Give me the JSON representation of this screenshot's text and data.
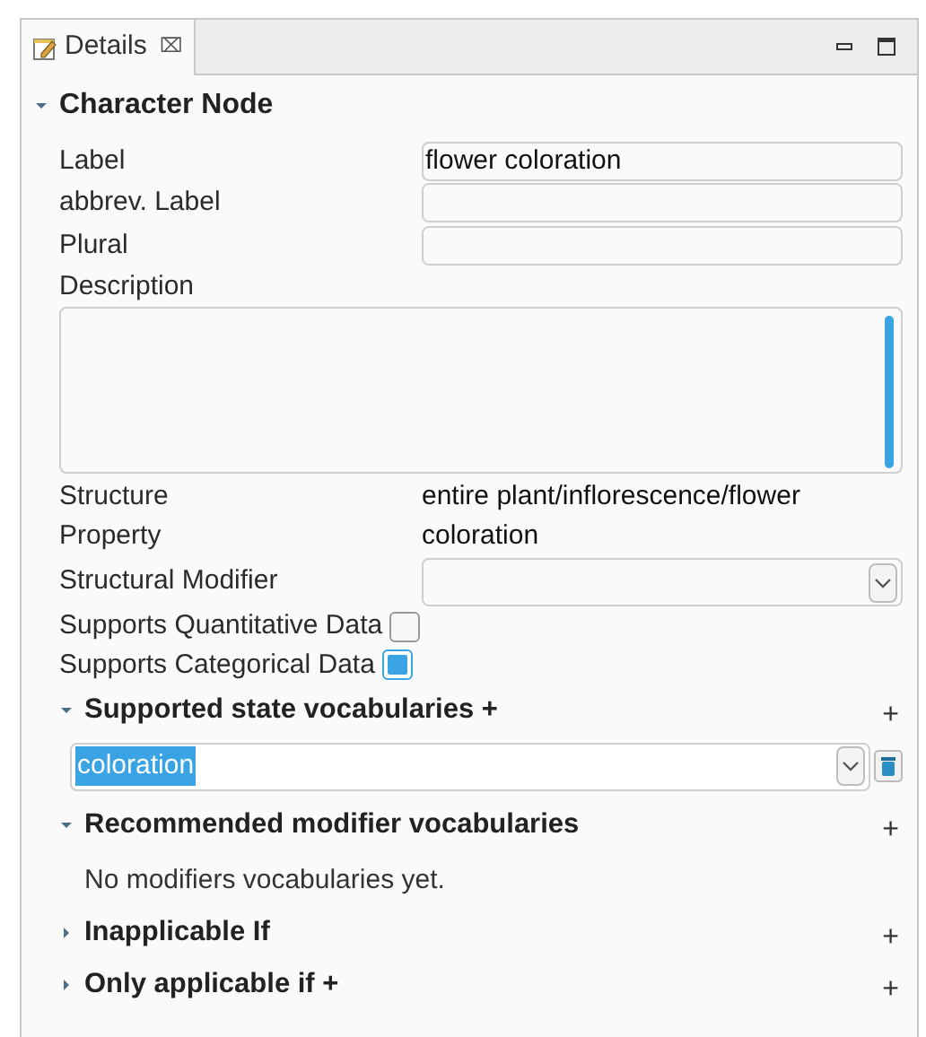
{
  "tab": {
    "label": "Details",
    "close": "⌧",
    "selected": true
  },
  "section": {
    "title": "Character Node",
    "expanded": true
  },
  "text_fields": [
    {
      "label": "Label",
      "value": "flower coloration"
    },
    {
      "label": "abbrev. Label"
    },
    {
      "label": "Plural"
    }
  ],
  "description": {
    "label": "Description"
  },
  "info": [
    {
      "label": "Structure",
      "value": "entire plant/inflorescence/flower"
    },
    {
      "label": "Property",
      "value": "coloration"
    }
  ],
  "structural_modifier": {
    "label": "Structural Modifier"
  },
  "checkboxes": [
    {
      "label": "Supports Quantitative Data",
      "checked": false
    },
    {
      "label": "Supports Categorical Data",
      "checked": true
    }
  ],
  "subsections": [
    {
      "title": "Supported state vocabularies +",
      "add": "+",
      "expanded": true,
      "combos": [
        {
          "value": "coloration",
          "selected": true
        }
      ]
    },
    {
      "title": "Recommended modifier vocabularies",
      "add": "+",
      "expanded": true,
      "message": "No modifiers vocabularies yet."
    },
    {
      "title": "Inapplicable If",
      "add": "+",
      "expanded": false
    },
    {
      "title": "Only applicable if +",
      "add": "+",
      "expanded": false
    }
  ]
}
